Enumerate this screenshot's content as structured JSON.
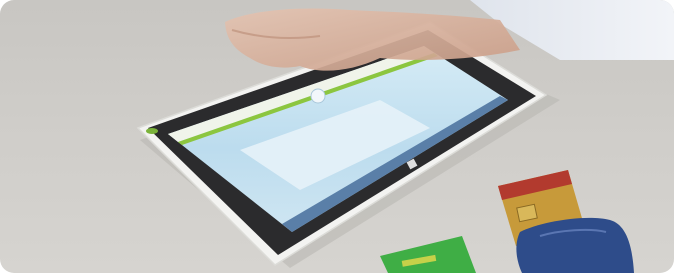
{
  "photo": {
    "description_hidden": "",
    "colors": {
      "table": "#cfcdc9",
      "tablet_body": "#f3f3f1",
      "tablet_bezel": "#2b2b2d",
      "screen": "#bfe0f2",
      "card_green": "#3fae45",
      "card_gold": "#c79a3a",
      "card_red": "#b23a2e",
      "reader_blue": "#2e4c8a",
      "skin": "#d8b4a0",
      "sleeve": "#e8ecf2"
    }
  }
}
